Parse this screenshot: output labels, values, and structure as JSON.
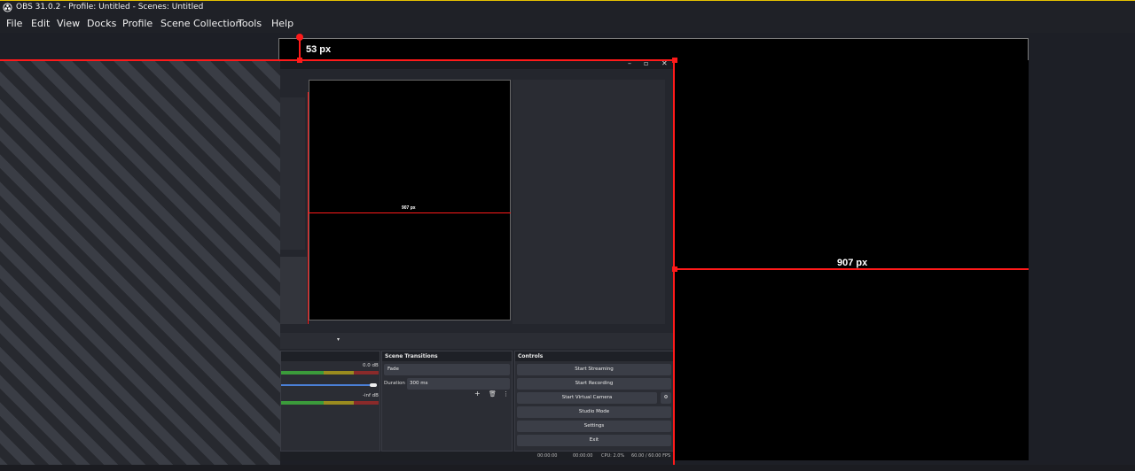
{
  "window": {
    "title": "OBS 31.0.2 - Profile: Untitled - Scenes: Untitled"
  },
  "menu": [
    "File",
    "Edit",
    "View",
    "Docks",
    "Profile",
    "Scene Collection",
    "Tools",
    "Help"
  ],
  "measurements": {
    "top_label": "53 px",
    "width_label": "907 px",
    "nested_width_label": "907 px"
  },
  "nested": {
    "scene_transitions": {
      "title": "Scene Transitions",
      "transition": "Fade",
      "duration_label": "Duration",
      "duration_value": "300 ms"
    },
    "controls": {
      "title": "Controls",
      "buttons": [
        "Start Streaming",
        "Start Recording",
        "Start Virtual Camera",
        "Studio Mode",
        "Settings",
        "Exit"
      ]
    },
    "audio": {
      "db1": "0.0 dB",
      "db2": "-inf dB"
    },
    "status": {
      "time1": "00:00:00",
      "time2": "00:00:00",
      "cpu": "CPU: 2.0%",
      "fps": "60.00 / 60.00 FPS"
    }
  },
  "colors": {
    "guide": "#ff1a1a",
    "titlebar_accent": "#e5c100"
  }
}
